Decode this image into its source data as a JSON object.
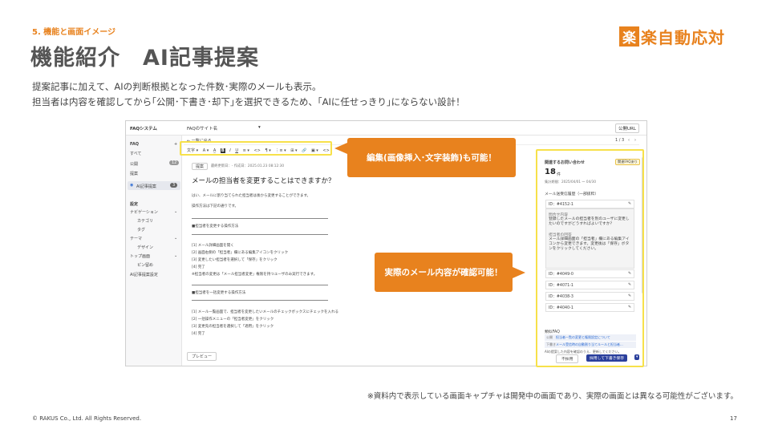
{
  "slide": {
    "section": "5. 機能と画面イメージ",
    "title": "機能紹介　AI記事提案",
    "brand_mark": "楽",
    "brand_text": "楽自動応対",
    "desc1": "提案記事に加えて、AIの判断根拠となった件数･実際のメールも表示。",
    "desc2": "担当者は内容を確認してから｢公開･下書き･却下｣を選択できるため、｢AIに任せっきり｣にならない設計！",
    "callout_edit": "編集(画像挿入･文字装飾)も可能！",
    "callout_mail": "実際のメール内容が確認可能！",
    "note": "※資料内で表示している画面キャプチャは開発中の画面であり、実際の画面とは異なる可能性がございます。",
    "copyright": "© RAKUS Co., Ltd. All Rights Reserved.",
    "page": "17",
    "colors": {
      "accent": "#e8821e",
      "highlight": "#f7e14a",
      "primary_button": "#2a3f9c"
    }
  },
  "app": {
    "brand": "FAQシステム",
    "site_select": "FAQのサイト名",
    "public_url_btn": "公開URL",
    "back_link": "← 一覧に戻る",
    "pager": "1 / 3",
    "sidebar": {
      "faq": "FAQ",
      "all": "すべて",
      "published": "公開",
      "published_count": "12",
      "proposal": "提案",
      "ai_proposal": "AI記事提案",
      "ai_count": "3",
      "settings": "設定",
      "navigation": "ナビゲーション",
      "category": "カテゴリ",
      "tag": "タグ",
      "theme": "テーマ",
      "design": "デザイン",
      "top_page": "トップ画面",
      "pinned": "ピン留め",
      "ai_setting": "AI記事提案設定"
    },
    "toolbar": [
      "文字 ▾",
      "A ▾",
      "A̲",
      "B",
      "I",
      "U",
      "≡ ▾",
      "<>",
      "¶ ▾",
      "⋮≡ ▾",
      "⊞ ▾",
      "🔗",
      "▣ ▾",
      "<>"
    ],
    "status_badge": "提案",
    "meta": "最終更新日：- 作成日：2025.01.23 08:12:30",
    "article_title": "メールの担当者を変更することはできますか？",
    "body": [
      "はい、メールに割り当てられた担当者は後から変更することができます。",
      "操作方法は下記の通りです。",
      "■担当者を変更する操作方法",
      "[1] メール詳細画面を開く",
      "[2] 画面右側の「担当者」欄にある編集アイコンをクリック",
      "[3] 変更したい担当者を選択して「保存」をクリック",
      "[4] 完了",
      "※担当者の変更は「メール担当者変更」権限を持つユーザのみ実行できます。",
      "■担当者を一括変更する操作方法",
      "[1] メール一覧画面で、担当者を変更したいメールのチェックボックスにチェックを入れる",
      "[2] 一括操作メニューの「担当者変更」をクリック",
      "[3] 変更先の担当者を選択して「適用」をクリック",
      "[4] 完了"
    ],
    "preview_btn": "プレビュー",
    "panel": {
      "title": "関連するお問い合わせ",
      "badge": "関連FAQあり",
      "count": "18",
      "count_unit": "件",
      "period": "集計期間：2025/04/01 〜 04/30",
      "list_label": "メール送受信履歴（一部抜粋）",
      "mails": [
        "ID：#4152-1",
        "ID：#4049-0",
        "ID：#4071-1",
        "ID：#4038-3",
        "ID：#4040-1"
      ],
      "q_label": "問合せ内容",
      "q_text": "登録したメールの担当者を別のユーザに変更したいのですがどうすればよいですか？",
      "a_label": "担当者の回答",
      "a_text": "メール詳細画面の「担当者」欄にある編集アイコンから変更できます。変更後は「保存」ボタンをクリックしてください。",
      "related_label": "類似FAQ",
      "related": [
        {
          "tag": "公開",
          "text": "担当者一覧の変更と権限設定について"
        },
        {
          "tag": "下書き",
          "text": "メール受信時の自動割り当てルールと担当者..."
        }
      ],
      "notice": "AIの提案した内容を確認のうえ、更新してください。",
      "reject_btn": "不採用",
      "draft_btn": "採用して下書き保存",
      "caret": "▾"
    }
  }
}
